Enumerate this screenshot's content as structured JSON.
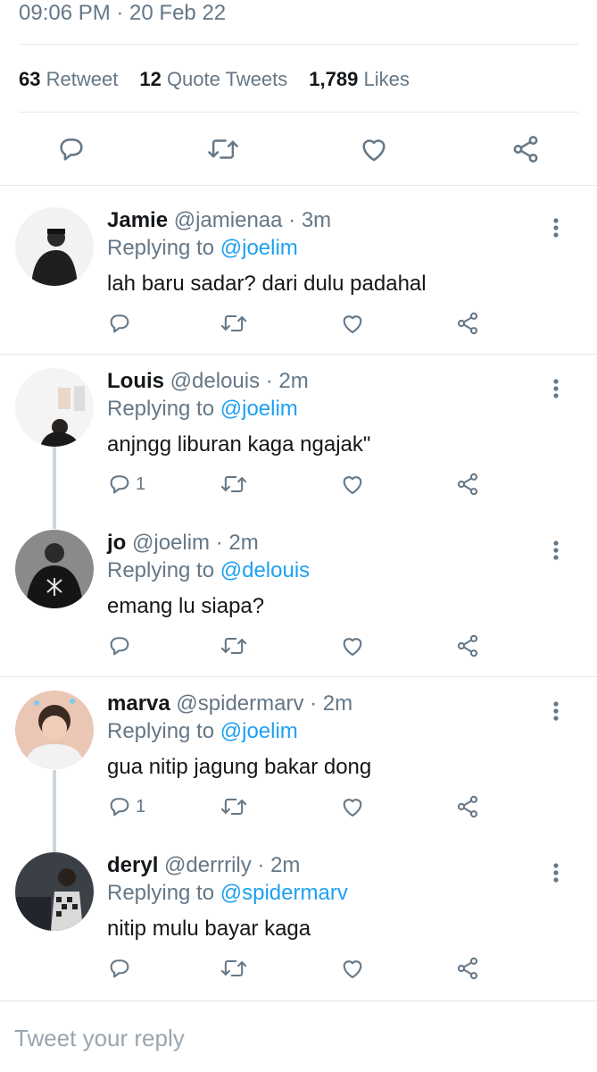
{
  "tweet": {
    "timestamp": "09:06 PM · 20 Feb 22",
    "stats": [
      {
        "num": "63",
        "label": "Retweet"
      },
      {
        "num": "12",
        "label": "Quote Tweets"
      },
      {
        "num": "1,789",
        "label": "Likes"
      }
    ]
  },
  "replies": [
    {
      "name": "Jamie",
      "handle": "@jamienaa · 3m",
      "replying_prefix": "Replying to ",
      "replying_to": "@joelim",
      "text": "lah baru sadar? dari dulu padahal",
      "reply_count": ""
    },
    {
      "name": "Louis",
      "handle": "@delouis · 2m",
      "replying_prefix": "Replying to ",
      "replying_to": "@joelim",
      "text": "anjngg liburan kaga ngajak\"",
      "reply_count": "1"
    },
    {
      "name": "jo",
      "handle": "@joelim · 2m",
      "replying_prefix": "Replying to ",
      "replying_to": "@delouis",
      "text": "emang lu siapa?",
      "reply_count": ""
    },
    {
      "name": "marva",
      "handle": "@spidermarv · 2m",
      "replying_prefix": "Replying to ",
      "replying_to": "@joelim",
      "text": "gua nitip jagung bakar dong",
      "reply_count": "1"
    },
    {
      "name": "deryl",
      "handle": "@derrrily · 2m",
      "replying_prefix": "Replying to ",
      "replying_to": "@spidermarv",
      "text": "nitip mulu bayar kaga",
      "reply_count": ""
    }
  ],
  "compose": {
    "placeholder": "Tweet your reply"
  },
  "colors": {
    "accent": "#1da1f2",
    "muted": "#657786",
    "divider": "#e1e8ed",
    "icon": "#657786"
  },
  "icons": [
    "reply-icon",
    "retweet-icon",
    "like-icon",
    "share-icon",
    "more-icon"
  ]
}
